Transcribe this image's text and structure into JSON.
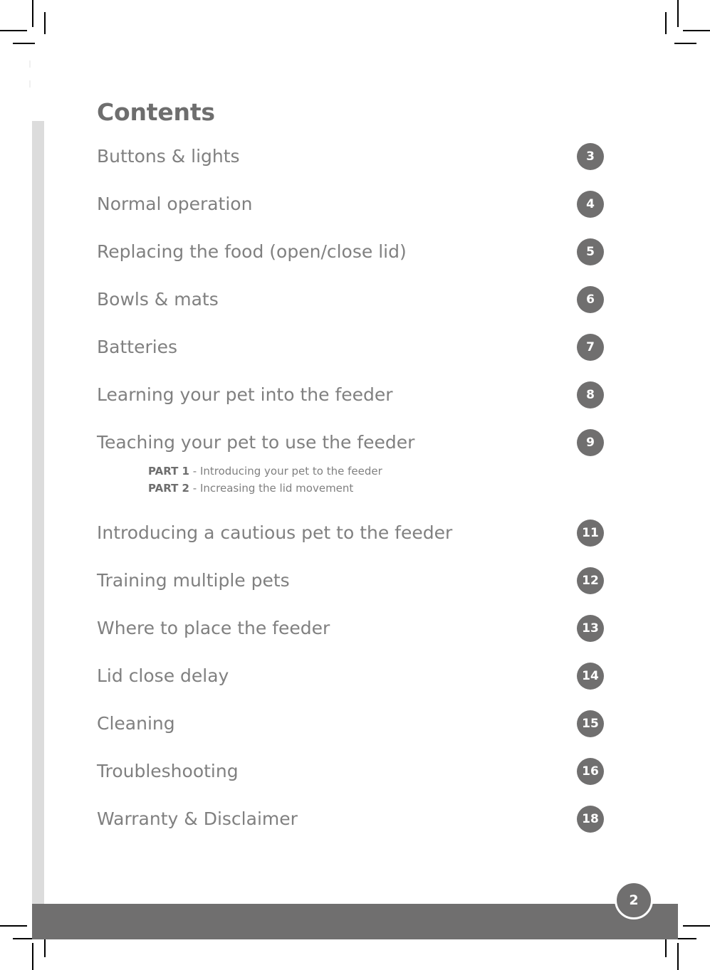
{
  "page": {
    "title": "Contents",
    "footer_page_number": "2"
  },
  "toc": {
    "items": [
      {
        "label": "Buttons & lights",
        "page": "3"
      },
      {
        "label": "Normal operation",
        "page": "4"
      },
      {
        "label": "Replacing the food (open/close lid)",
        "page": "5"
      },
      {
        "label": "Bowls & mats",
        "page": "6"
      },
      {
        "label": "Batteries",
        "page": "7"
      },
      {
        "label": "Learning your pet into the feeder",
        "page": "8"
      },
      {
        "label": "Teaching your pet to use the feeder",
        "page": "9",
        "sub": [
          {
            "part": "PART 1",
            "text": " - Introducing your pet to the feeder"
          },
          {
            "part": "PART 2",
            "text": " - Increasing the lid movement"
          }
        ]
      },
      {
        "label": "Introducing a cautious pet to the feeder",
        "page": "11"
      },
      {
        "label": "Training multiple pets",
        "page": "12"
      },
      {
        "label": "Where to place the feeder",
        "page": "13"
      },
      {
        "label": "Lid close delay",
        "page": "14"
      },
      {
        "label": "Cleaning",
        "page": "15"
      },
      {
        "label": "Troubleshooting",
        "page": "16"
      },
      {
        "label": "Warranty & Disclaimer",
        "page": "18"
      }
    ]
  },
  "colors": {
    "text_gray": "#808080",
    "heading_gray": "#6e6e6e",
    "badge_gray": "#706f6f",
    "accent_bar": "#dcdcdc",
    "footer_bar": "#706f6f"
  }
}
